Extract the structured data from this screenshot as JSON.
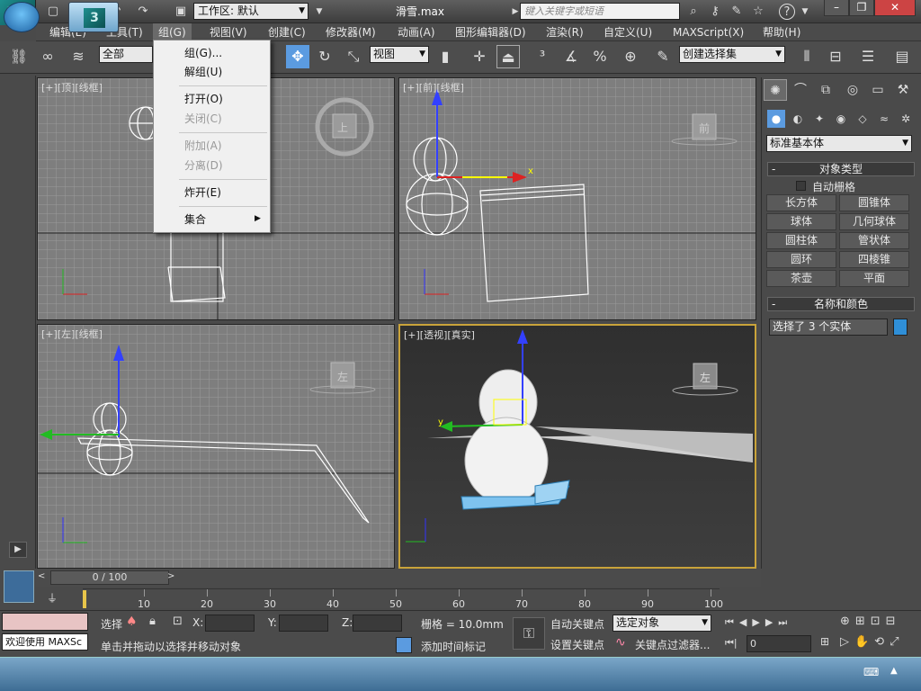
{
  "titlebar": {
    "workspace_label": "工作区: 默认",
    "doc_title": "滑雪.max",
    "search_placeholder": "键入关键字或短语",
    "app_logo": "3ds-max-logo",
    "quick_icons": [
      "new-icon",
      "open-icon",
      "save-icon",
      "undo-icon",
      "redo-icon",
      "project-icon"
    ],
    "right_icons": [
      "binoculars-icon",
      "search-icon",
      "star-icon",
      "help-icon"
    ],
    "help_label": "?"
  },
  "menubar": {
    "items": [
      "编辑(E)",
      "工具(T)",
      "组(G)",
      "视图(V)",
      "创建(C)",
      "修改器(M)",
      "动画(A)",
      "图形编辑器(D)",
      "渲染(R)",
      "自定义(U)",
      "MAXScript(X)",
      "帮助(H)"
    ],
    "active": "组(G)"
  },
  "toolbar": {
    "filter_value": "全部",
    "refcoord_value": "视图",
    "named_selection": "创建选择集"
  },
  "group_menu": {
    "items": [
      {
        "label": "组(G)...",
        "disabled": false
      },
      {
        "label": "解组(U)",
        "disabled": false
      },
      {
        "label": "打开(O)",
        "disabled": false
      },
      {
        "label": "关闭(C)",
        "disabled": true
      },
      {
        "label": "附加(A)",
        "disabled": true
      },
      {
        "label": "分离(D)",
        "disabled": true
      },
      {
        "label": "炸开(E)",
        "disabled": false
      },
      {
        "label": "集合",
        "disabled": false
      }
    ],
    "submenu_arrow": "▶"
  },
  "viewports": {
    "top": {
      "label": "[+][顶][线框]",
      "cube": "上"
    },
    "front": {
      "label": "[+][前][线框]",
      "cube": "前"
    },
    "left": {
      "label": "[+][左][线框]",
      "cube": "左"
    },
    "persp": {
      "label": "[+][透视][真实]",
      "cube": "左"
    }
  },
  "command_panel": {
    "category_value": "标准基本体",
    "object_type_header": "对象类型",
    "autogrid_label": "自动栅格",
    "buttons": [
      "长方体",
      "圆锥体",
      "球体",
      "几何球体",
      "圆柱体",
      "管状体",
      "圆环",
      "四棱锥",
      "茶壶",
      "平面"
    ],
    "name_color_header": "名称和颜色",
    "name_value": "选择了 3 个实体",
    "object_color": "#2f8fd8"
  },
  "timeline": {
    "slider_label": "0 / 100",
    "ticks": [
      10,
      20,
      30,
      40,
      50,
      60,
      70,
      80,
      90,
      100
    ]
  },
  "status": {
    "maxscript_label": "欢迎使用 MAXSc",
    "selection_text": "选择",
    "prompt_text": "单击并拖动以选择并移动对象",
    "x_label": "X:",
    "y_label": "Y:",
    "z_label": "Z:",
    "grid_label": "栅格 = 10.0mm",
    "add_time_tag": "添加时间标记",
    "auto_key": "自动关键点",
    "set_key": "设置关键点",
    "key_mode_value": "选定对象",
    "key_filters": "关键点过滤器...",
    "frame_value": "0"
  }
}
